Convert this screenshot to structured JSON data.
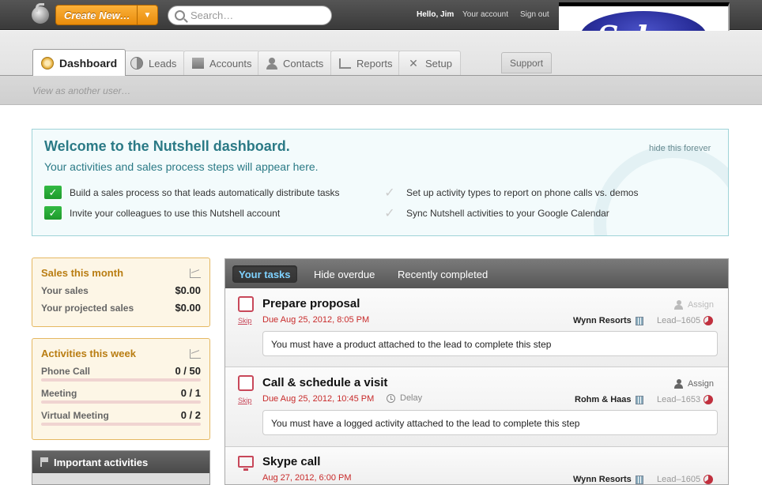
{
  "header": {
    "create_label": "Create New…",
    "search_placeholder": "Search…",
    "hello": "Hello, Jim",
    "account_link": "Your account",
    "signout_link": "Sign out"
  },
  "sabre": {
    "logo_text": "Sabre"
  },
  "tabs": [
    {
      "label": "Dashboard",
      "icon": "dashboard-icon",
      "active": true
    },
    {
      "label": "Leads",
      "icon": "leads-icon"
    },
    {
      "label": "Accounts",
      "icon": "accounts-icon"
    },
    {
      "label": "Contacts",
      "icon": "contacts-icon"
    },
    {
      "label": "Reports",
      "icon": "reports-icon"
    },
    {
      "label": "Setup",
      "icon": "setup-icon"
    }
  ],
  "support_label": "Support",
  "subbar": {
    "view_as": "View as another user…"
  },
  "welcome": {
    "title": "Welcome to the Nutshell dashboard.",
    "subtitle": "Your activities and sales process steps will appear here.",
    "hide_link": "hide this forever",
    "items": [
      {
        "text": "Build a sales process so that leads automatically distribute tasks",
        "done": true
      },
      {
        "text": "Invite your colleagues to use this Nutshell account",
        "done": true
      },
      {
        "text": "Set up activity types to report on phone calls vs. demos",
        "done": false
      },
      {
        "text": "Sync Nutshell activities to your Google Calendar",
        "done": false
      }
    ]
  },
  "sales_month": {
    "title": "Sales this month",
    "rows": [
      {
        "label": "Your sales",
        "value": "$0.00"
      },
      {
        "label": "Your projected sales",
        "value": "$0.00"
      }
    ]
  },
  "activities_week": {
    "title": "Activities this week",
    "rows": [
      {
        "label": "Phone Call",
        "value": "0 / 50",
        "progress": 0
      },
      {
        "label": "Meeting",
        "value": "0 / 1",
        "progress": 0
      },
      {
        "label": "Virtual Meeting",
        "value": "0 / 2",
        "progress": 0
      }
    ]
  },
  "important": {
    "title": "Important activities"
  },
  "tasks_tabs": [
    {
      "label": "Your tasks",
      "active": true
    },
    {
      "label": "Hide overdue"
    },
    {
      "label": "Recently completed"
    }
  ],
  "tasks": [
    {
      "title": "Prepare proposal",
      "due": "Due Aug 25, 2012, 8:05 PM",
      "skip": "Skip",
      "assign": "Assign",
      "company": "Wynn Resorts",
      "lead": "Lead–1605",
      "note": "You must have a product attached to the lead to complete this step"
    },
    {
      "title": "Call & schedule a visit",
      "due": "Due Aug 25, 2012, 10:45 PM",
      "delay": "Delay",
      "skip": "Skip",
      "assign": "Assign",
      "company": "Rohm & Haas",
      "lead": "Lead–1653",
      "note": "You must have a logged activity attached to the lead to complete this step"
    },
    {
      "title": "Skype call",
      "due": "Aug 27, 2012, 6:00 PM",
      "company": "Wynn Resorts",
      "lead": "Lead–1605"
    }
  ],
  "colors": {
    "accent_orange": "#f0a020",
    "teal": "#2b7a86",
    "task_red": "#c8485a",
    "check_green": "#1e9a2c"
  }
}
